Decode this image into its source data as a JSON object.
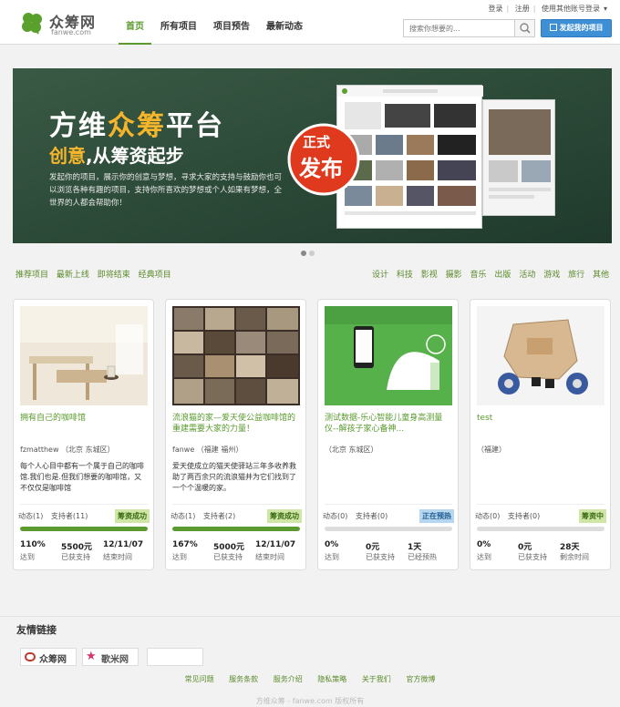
{
  "header": {
    "logo_cn": "众筹网",
    "logo_en": "fanwe.com",
    "nav": [
      {
        "label": "首页",
        "active": true
      },
      {
        "label": "所有项目",
        "active": false
      },
      {
        "label": "项目预告",
        "active": false
      },
      {
        "label": "最新动态",
        "active": false
      }
    ],
    "top_links": {
      "login": "登录",
      "register": "注册",
      "other_login": "使用其他账号登录"
    },
    "search_placeholder": "搜索你想要的...",
    "launch_button": "发起我的项目"
  },
  "banner": {
    "title_pre": "方维",
    "title_hl": "众筹",
    "title_post": "平台",
    "sub_hl": "创意",
    "sub_post": ",从筹资起步",
    "desc": "发起你的项目，展示你的创意与梦想，寻求大家的支持与鼓励你也可以浏览各种有趣的项目，支持你所喜欢的梦想或个人如果有梦想，全世界的人都会帮助你！",
    "badge_line1": "正式",
    "badge_line2": "发布"
  },
  "filters": {
    "left": [
      "推荐项目",
      "最新上线",
      "即将结束",
      "经典项目"
    ],
    "right": [
      "设计",
      "科技",
      "影视",
      "摄影",
      "音乐",
      "出版",
      "活动",
      "游戏",
      "旅行",
      "其他"
    ]
  },
  "cards": [
    {
      "title": "拥有自己的咖啡馆",
      "owner": "fzmatthew （北京 东城区）",
      "desc": "每个人心目中都有一个属于自己的咖啡馆.我们也是.但我们想要的咖啡馆，又不仅仅是咖啡馆",
      "updates": "动态(1)",
      "supporters": "支持者(11)",
      "status": "筹资成功",
      "status_color": "green",
      "progress": 1.0,
      "percent": "110%",
      "amount": "5500元",
      "end": "12/11/07",
      "percent_label": "达到",
      "amount_label": "已获支持",
      "end_label": "结束时间"
    },
    {
      "title": "流浪猫的家—爱天使公益咖啡馆的重建需要大家的力量！",
      "owner": "fanwe （福建 福州）",
      "desc": "爱天使成立的猫天使驿站三年多收养救助了两百余只的流浪猫并为它们找到了一个个温暖的家。",
      "updates": "动态(1)",
      "supporters": "支持者(2)",
      "status": "筹资成功",
      "status_color": "green",
      "progress": 1.0,
      "percent": "167%",
      "amount": "5000元",
      "end": "12/11/07",
      "percent_label": "达到",
      "amount_label": "已获支持",
      "end_label": "结束时间"
    },
    {
      "title": "测试数据-乐心智能儿童身高测量仪--解孩子家心备神...",
      "owner": "（北京 东城区）",
      "desc": "",
      "updates": "动态(0)",
      "supporters": "支持者(0)",
      "status": "正在预热",
      "status_color": "blue",
      "progress": 0,
      "percent": "0%",
      "amount": "0元",
      "end": "1天",
      "percent_label": "达到",
      "amount_label": "已获支持",
      "end_label": "已经预热"
    },
    {
      "title": "test",
      "owner": "（福建）",
      "desc": "",
      "updates": "动态(0)",
      "supporters": "支持者(0)",
      "status": "筹资中",
      "status_color": "green",
      "progress": 0,
      "percent": "0%",
      "amount": "0元",
      "end": "28天",
      "percent_label": "达到",
      "amount_label": "已获支持",
      "end_label": "剩余时间"
    }
  ],
  "footer": {
    "friend_title": "友情链接",
    "friend_links": [
      "众筹网",
      "歌米网"
    ],
    "links": [
      "常见问题",
      "服务条款",
      "服务介绍",
      "隐私策略",
      "关于我们",
      "官方微博"
    ],
    "copyright": "方维众筹 - fanwe.com 版权所有"
  },
  "colors": {
    "brand_green": "#5a9a2e",
    "accent_blue": "#3d8fd6",
    "banner_bg": "#2b4a38",
    "highlight": "#f5b62b"
  }
}
